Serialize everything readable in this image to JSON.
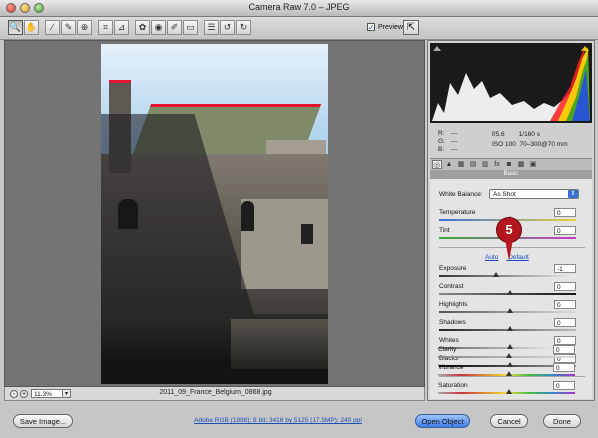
{
  "window": {
    "title": "Camera Raw 7.0  –  JPEG"
  },
  "toolbar": {
    "tools": [
      "zoom-icon",
      "hand-icon",
      "white-balance-icon",
      "color-sampler-icon",
      "targeted-adjustment-icon",
      "crop-icon",
      "straighten-icon",
      "spot-removal-icon",
      "red-eye-icon",
      "adjustment-brush-icon",
      "graduated-filter-icon",
      "preferences-icon",
      "rotate-ccw-icon",
      "rotate-cw-icon"
    ],
    "tool_glyphs": [
      "🔍",
      "✋",
      "⁄",
      "✎",
      "⊕",
      "⌗",
      "⊿",
      "✿",
      "◉",
      "✐",
      "▭",
      "☰",
      "↺",
      "↻"
    ],
    "preview_label": "Preview",
    "fullscreen_glyph": "⇱"
  },
  "status": {
    "zoom": "11.3%",
    "zoom_arrow": "▾",
    "filename": "2011_09_France_Belgium_0868.jpg",
    "minus": "-",
    "plus": "+"
  },
  "info": {
    "r_label": "R:",
    "g_label": "G:",
    "b_label": "B:",
    "r_val": "---",
    "g_val": "---",
    "b_val": "---",
    "aperture": "f/5.6",
    "shutter": "1/160 s",
    "iso": "ISO 100",
    "lens": "70–300@70 mm"
  },
  "panel": {
    "tab_glyphs": [
      "◎",
      "▲",
      "▦",
      "▤",
      "▥",
      "fx",
      "◙",
      "▩",
      "▣"
    ],
    "tab_names": [
      "basic-tab",
      "tone-curve-tab",
      "detail-tab",
      "hsl-tab",
      "split-toning-tab",
      "effects-tab",
      "camera-calibration-tab",
      "presets-tab",
      "snapshots-tab"
    ],
    "header": "Basic",
    "white_balance_label": "White Balance:",
    "white_balance_value": "As Shot",
    "white_balance_arrow": "⇕",
    "auto": "Auto",
    "default": "Default",
    "sliders": [
      {
        "label": "Temperature",
        "value": "0"
      },
      {
        "label": "Tint",
        "value": "0"
      },
      {
        "label": "Exposure",
        "value": "-1"
      },
      {
        "label": "Contrast",
        "value": "0"
      },
      {
        "label": "Highlights",
        "value": "0"
      },
      {
        "label": "Shadows",
        "value": "0"
      },
      {
        "label": "Whites",
        "value": "0"
      },
      {
        "label": "Blacks",
        "value": "0"
      },
      {
        "label": "Clarity",
        "value": "0"
      },
      {
        "label": "Vibrance",
        "value": "0"
      },
      {
        "label": "Saturation",
        "value": "0"
      }
    ]
  },
  "callout": "5",
  "bottom": {
    "save_image": "Save Image...",
    "workflow_link": "Adobe RGB (1998); 8 bit; 3416 by 5125 (17.5MP); 240 ppi",
    "open_object": "Open Object",
    "cancel": "Cancel",
    "done": "Done"
  },
  "colors": {
    "accent": "#3b6fd8",
    "clip_warning": "#e5132e",
    "callout": "#b3161c"
  }
}
